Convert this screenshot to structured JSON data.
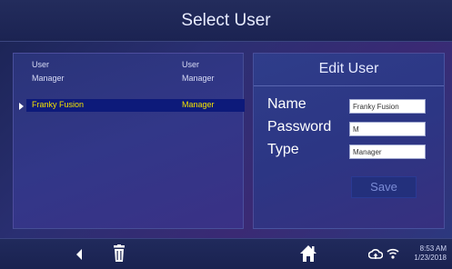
{
  "title": "Select User",
  "user_list": {
    "header": {
      "name": "User",
      "type": "User"
    },
    "rows": [
      {
        "name": "Manager",
        "type": "Manager"
      },
      {
        "name": "Franky Fusion",
        "type": "Manager",
        "selected": true
      }
    ]
  },
  "edit_panel": {
    "title": "Edit User",
    "name_label": "Name",
    "name_value": "Franky Fusion",
    "password_label": "Password",
    "password_value": "M",
    "type_label": "Type",
    "type_value": "Manager",
    "save_label": "Save"
  },
  "status": {
    "time": "8:53 AM",
    "date": "1/23/2018"
  },
  "colors": {
    "selected_text": "#f5e400",
    "selected_bg": "#0d1a7a"
  },
  "icons": [
    "back-arrow-icon",
    "trash-icon",
    "home-icon",
    "cloud-upload-icon",
    "wifi-icon"
  ]
}
